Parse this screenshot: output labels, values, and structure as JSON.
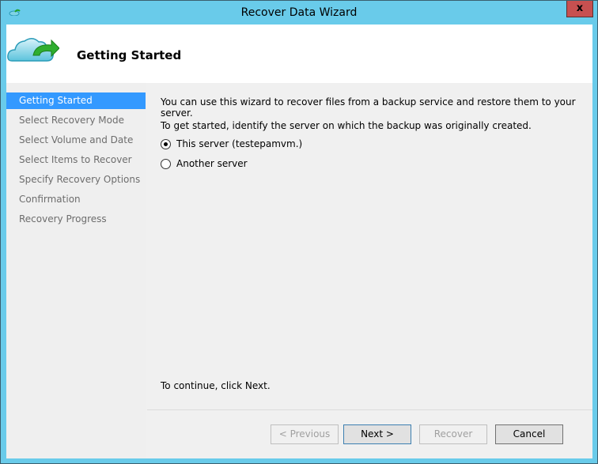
{
  "window": {
    "title": "Recover Data Wizard",
    "close_label": "x",
    "colors": {
      "titlebar": "#69cbea",
      "close": "#c75050",
      "selected": "#3399ff"
    }
  },
  "header": {
    "title": "Getting Started",
    "icon": "cloud-recover-icon"
  },
  "sidebar": {
    "items": [
      {
        "label": "Getting Started",
        "active": true
      },
      {
        "label": "Select Recovery Mode"
      },
      {
        "label": "Select Volume and Date"
      },
      {
        "label": "Select Items to Recover"
      },
      {
        "label": "Specify Recovery Options"
      },
      {
        "label": "Confirmation"
      },
      {
        "label": "Recovery Progress"
      }
    ]
  },
  "main": {
    "intro": "You can use this wizard to recover files from a backup service and restore them to your server.",
    "prompt": "To get started, identify the server on which the backup was originally created.",
    "options": [
      {
        "label": "This server (testepamvm.)",
        "selected": true
      },
      {
        "label": "Another server",
        "selected": false
      }
    ],
    "continue_text": "To continue, click Next."
  },
  "buttons": {
    "previous": "< Previous",
    "next": "Next >",
    "recover": "Recover",
    "cancel": "Cancel"
  }
}
